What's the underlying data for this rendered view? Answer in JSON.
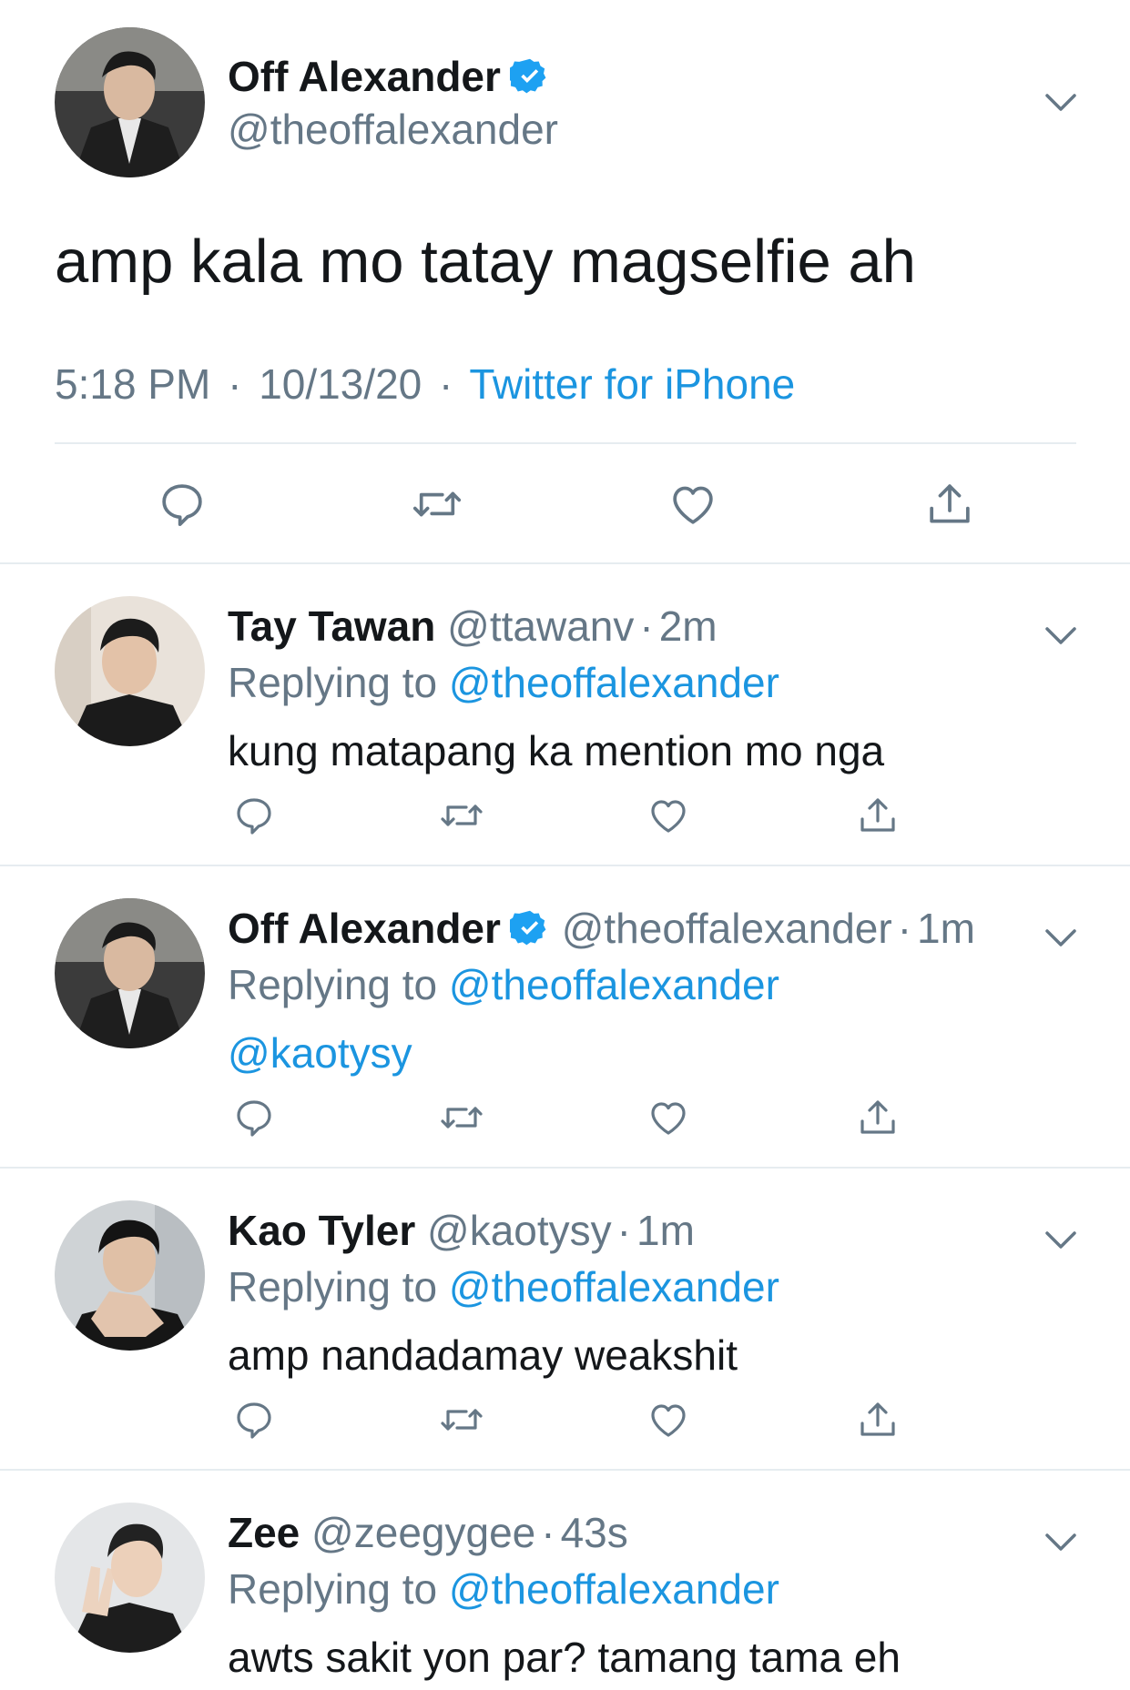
{
  "main_tweet": {
    "name": "Off Alexander",
    "handle": "@theoffalexander",
    "text": "amp kala mo tatay magselfie ah",
    "time": "5:18 PM",
    "date": "10/13/20",
    "separator": "·",
    "source": "Twitter for iPhone",
    "verified": true
  },
  "replies": [
    {
      "name": "Tay Tawan",
      "handle": "@ttawanv",
      "separator": "·",
      "age": "2m",
      "replying_label": "Replying to",
      "replying_to": "@theoffalexander",
      "text": "kung matapang ka mention mo nga",
      "verified": false
    },
    {
      "name": "Off Alexander",
      "handle": "@theoffalexander",
      "separator": "·",
      "age": "1m",
      "replying_label": "Replying to",
      "replying_to": "@theoffalexander",
      "text": "@kaotysy",
      "verified": true
    },
    {
      "name": "Kao Tyler",
      "handle": "@kaotysy",
      "separator": "·",
      "age": "1m",
      "replying_label": "Replying to",
      "replying_to": "@theoffalexander",
      "text": "amp nandadamay weakshit",
      "verified": false
    },
    {
      "name": "Zee",
      "handle": "@zeegygee",
      "separator": "·",
      "age": "43s",
      "replying_label": "Replying to",
      "replying_to": "@theoffalexander",
      "text": "awts sakit yon par? tamang tama eh",
      "verified": false
    }
  ],
  "icons": {
    "reply": "reply-icon",
    "retweet": "retweet-icon",
    "like": "heart-icon",
    "share": "share-icon",
    "menu": "chevron-down-icon",
    "verified": "verified-badge-icon"
  },
  "colors": {
    "link": "#1b95e0",
    "secondary_text": "#657786",
    "verified": "#1da1f2",
    "divider": "#e6ecf0",
    "icon": "#657786"
  }
}
